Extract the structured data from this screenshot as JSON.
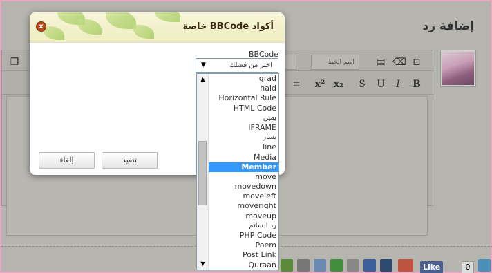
{
  "page": {
    "title": "إضافة رد"
  },
  "editor": {
    "font_select_placeholder": "اسم الخط"
  },
  "modal": {
    "title": "أكواد BBCode خاصة",
    "close_label": "x",
    "field_label": "BBCode",
    "select_value": "اختر من فضلك",
    "cancel_label": "إلغاء",
    "execute_label": "تنفيذ"
  },
  "dropdown": {
    "options": [
      "grad",
      "haid",
      "Horizontal Rule",
      "HTML Code",
      "يمين",
      "IFRAME",
      "يسار",
      "line",
      "Media",
      "Member",
      "move",
      "movedown",
      "moveleft",
      "moveright",
      "moveup",
      "رد الساتم",
      "PHP Code",
      "Poem",
      "Post Link",
      "Quraan"
    ],
    "selected_index": 9
  },
  "share_bar": {
    "like_label": "Like",
    "like_count": "0"
  },
  "colors": {
    "selected": "#3399ff",
    "close_button": "#b54719",
    "border_accent": "#e8a7c0"
  }
}
